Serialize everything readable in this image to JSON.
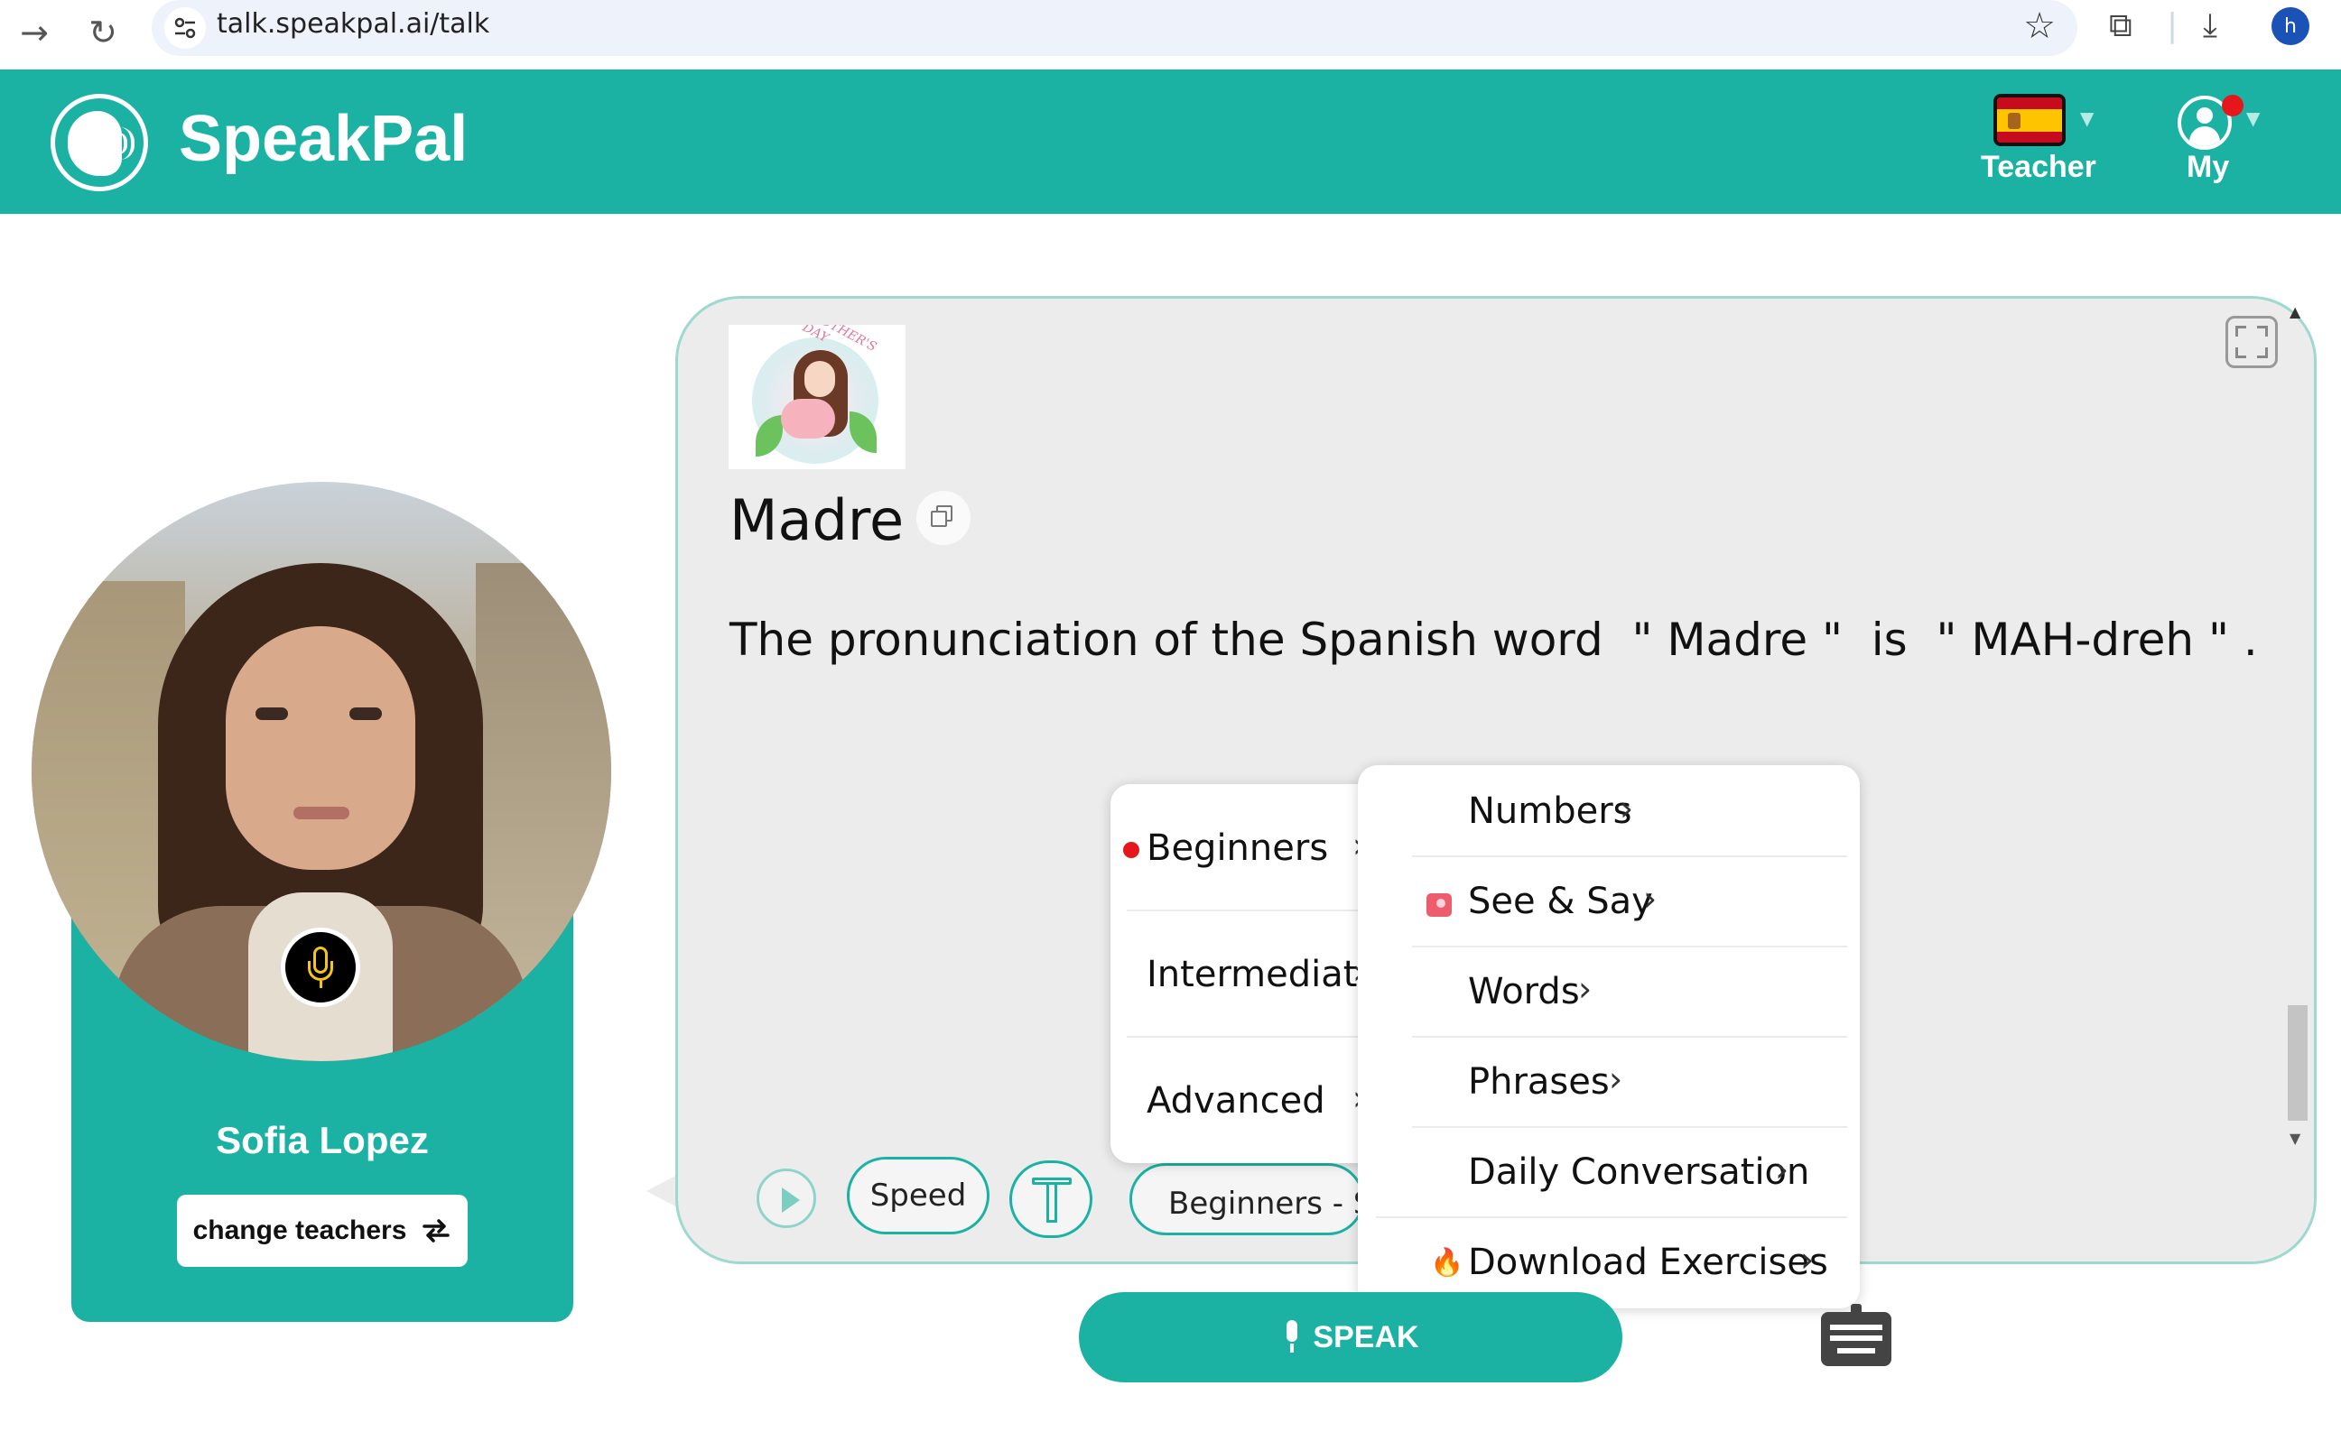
{
  "browser": {
    "url": "talk.speakpal.ai/talk",
    "profile_initial": "h"
  },
  "header": {
    "brand": "SpeakPal",
    "teacher_label": "Teacher",
    "my_label": "My",
    "flag": "spain-flag-icon"
  },
  "teacher": {
    "name": "Sofia Lopez",
    "change_label": "change teachers"
  },
  "chat": {
    "thumbnail_tag": "MOTHER'S DAY",
    "word": "Madre",
    "pronunciation": "The pronunciation of the Spanish word  \" Madre \"  is  \" MAH-dreh \" ."
  },
  "toolbar": {
    "speed_label": "Speed",
    "level_pill": "Beginners - Se"
  },
  "level_menu": {
    "items": [
      {
        "label": "Beginners",
        "selected": true
      },
      {
        "label": "Intermediate",
        "selected": false
      },
      {
        "label": "Advanced",
        "selected": false
      }
    ]
  },
  "category_menu": {
    "items": [
      {
        "label": "Numbers",
        "icon": ""
      },
      {
        "label": "See & Say",
        "icon": "photo-icon"
      },
      {
        "label": "Words",
        "icon": ""
      },
      {
        "label": "Phrases",
        "icon": ""
      },
      {
        "label": "Daily Conversation",
        "icon": ""
      },
      {
        "label": "Download Exercises",
        "icon": "fire-icon"
      }
    ]
  },
  "speak": {
    "label": "SPEAK"
  },
  "colors": {
    "brand": "#1bb2a4",
    "selected_dot": "#e5171c"
  }
}
